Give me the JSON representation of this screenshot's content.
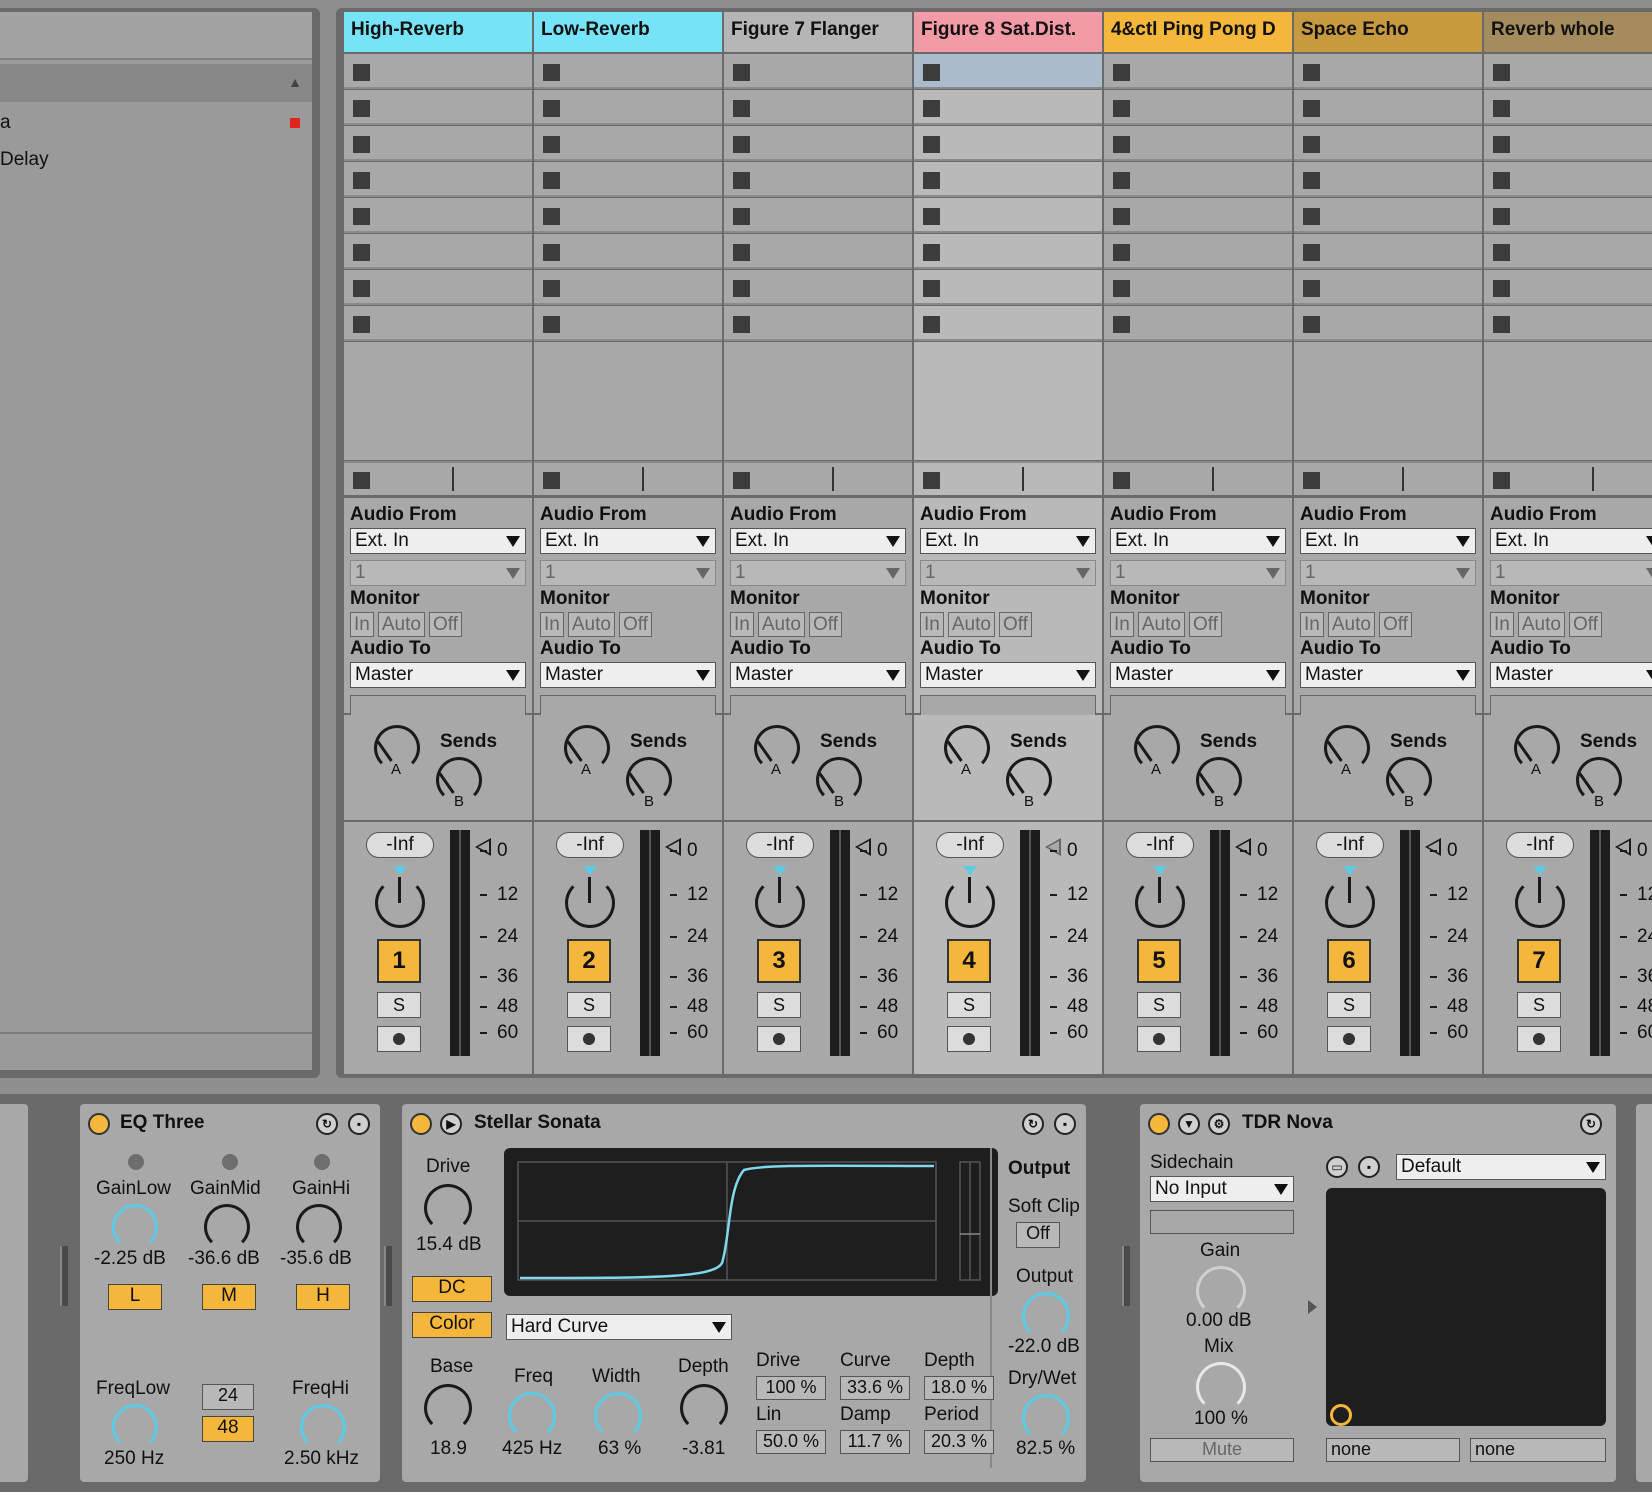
{
  "browser": {
    "items": [
      "a",
      "Delay"
    ]
  },
  "colors": {
    "cyan": "#76e3f7",
    "gray_title": "#b5b5b5",
    "pink": "#f29aa6",
    "orange": "#f5b63c",
    "gold": "#c89a40",
    "brown": "#a58c5e",
    "accent_blue": "#5ccbe6",
    "rec_red": "#e1251b"
  },
  "tracks": [
    {
      "name": "High-Reverb",
      "color": "#76e3f7",
      "num": "1"
    },
    {
      "name": "Low-Reverb",
      "color": "#76e3f7",
      "num": "2"
    },
    {
      "name": "Figure 7 Flanger",
      "color": "#b5b5b5",
      "num": "3"
    },
    {
      "name": "Figure 8 Sat.Dist.",
      "color": "#f29aa6",
      "num": "4"
    },
    {
      "name": "4&ctl Ping Pong D",
      "color": "#f5b63c",
      "num": "5"
    },
    {
      "name": "Space Echo",
      "color": "#c89a40",
      "num": "6"
    },
    {
      "name": "Reverb whole",
      "color": "#a58c5e",
      "num": "7"
    }
  ],
  "io": {
    "audio_from": "Audio From",
    "source": "Ext. In",
    "channel": "1",
    "monitor": "Monitor",
    "mon_in": "In",
    "mon_auto": "Auto",
    "mon_off": "Off",
    "audio_to": "Audio To",
    "dest": "Master"
  },
  "sends": {
    "label": "Sends",
    "a": "A",
    "b": "B"
  },
  "mixer": {
    "volume": "-Inf",
    "solo": "S",
    "scale": [
      "0",
      "12",
      "24",
      "36",
      "48",
      "60"
    ]
  },
  "eq_three": {
    "title": "EQ Three",
    "gain_low_label": "GainLow",
    "gain_mid_label": "GainMid",
    "gain_hi_label": "GainHi",
    "gain_low": "-2.25 dB",
    "gain_mid": "-36.6 dB",
    "gain_hi": "-35.6 dB",
    "btn_l": "L",
    "btn_m": "M",
    "btn_h": "H",
    "freq_low_label": "FreqLow",
    "freq_hi_label": "FreqHi",
    "freq_low": "250 Hz",
    "freq_hi": "2.50 kHz",
    "slope_24": "24",
    "slope_48": "48"
  },
  "stellar": {
    "title": "Stellar Sonata",
    "drive_label": "Drive",
    "drive": "15.4 dB",
    "dc": "DC",
    "color": "Color",
    "curve_type": "Hard Curve",
    "output_header": "Output",
    "soft_clip_label": "Soft Clip",
    "soft_clip": "Off",
    "output_label": "Output",
    "output": "-22.0 dB",
    "drywet_label": "Dry/Wet",
    "drywet": "82.5 %",
    "base_label": "Base",
    "base": "18.9",
    "freq_label": "Freq",
    "freq": "425 Hz",
    "width_label": "Width",
    "width": "63 %",
    "depth_label": "Depth",
    "depth": "-3.81",
    "p_drive_label": "Drive",
    "p_drive": "100 %",
    "p_curve_label": "Curve",
    "p_curve": "33.6 %",
    "p_depth_label": "Depth",
    "p_depth": "18.0 %",
    "p_lin_label": "Lin",
    "p_lin": "50.0 %",
    "p_damp_label": "Damp",
    "p_damp": "11.7 %",
    "p_period_label": "Period",
    "p_period": "20.3 %"
  },
  "nova": {
    "title": "TDR Nova",
    "sidechain_label": "Sidechain",
    "sidechain": "No Input",
    "gain_label": "Gain",
    "gain": "0.00 dB",
    "mix_label": "Mix",
    "mix": "100 %",
    "mute": "Mute",
    "preset": "Default",
    "none_1": "none",
    "none_2": "none"
  }
}
